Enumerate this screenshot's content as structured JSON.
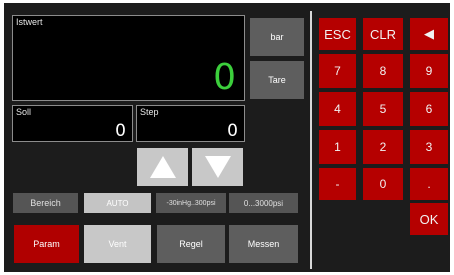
{
  "istwert": {
    "label": "Istwert",
    "value": "0"
  },
  "unit_button": "bar",
  "tare_button": "Tare",
  "soll": {
    "label": "Soll",
    "value": "0"
  },
  "step": {
    "label": "Step",
    "value": "0"
  },
  "mode_row": {
    "bereich": "Bereich",
    "auto": "AUTO",
    "range1": "-30inHg..300psi",
    "range2": "0...3000psi"
  },
  "tabs": {
    "param": "Param",
    "vent": "Vent",
    "regel": "Regel",
    "messen": "Messen"
  },
  "keypad": {
    "esc": "ESC",
    "clr": "CLR",
    "back": "◀",
    "k7": "7",
    "k8": "8",
    "k9": "9",
    "k4": "4",
    "k5": "5",
    "k6": "6",
    "k1": "1",
    "k2": "2",
    "k3": "3",
    "minus": "-",
    "k0": "0",
    "dot": ".",
    "ok": "OK"
  },
  "colors": {
    "istwert_value": "#3ccf3c",
    "keypad_red": "#b50000",
    "active_tab": "#b00000"
  }
}
